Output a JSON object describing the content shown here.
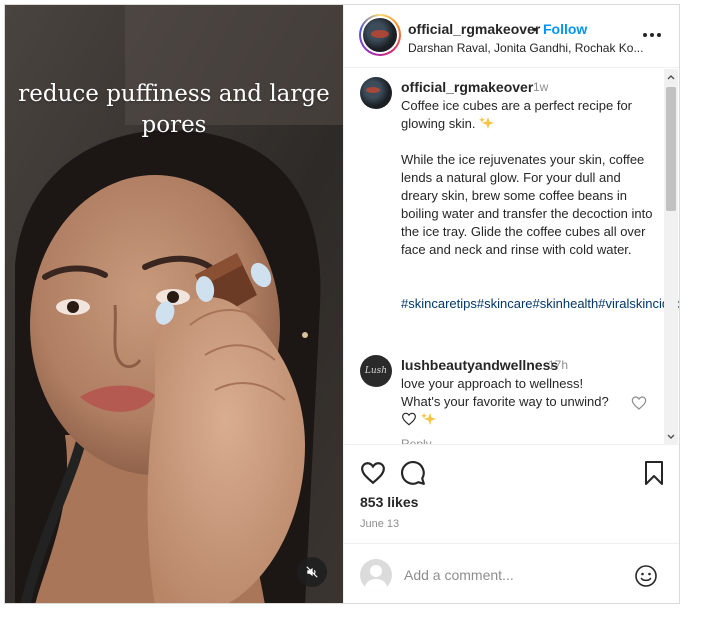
{
  "post": {
    "overlay_text": "reduce puffiness and large pores",
    "account": "official_rgmakeover",
    "follow_dot": "•",
    "follow_label": "Follow",
    "header_subtitle": "Darshan Raval, Jonita Gandhi, Rochak Ko..."
  },
  "caption": {
    "user": "official_rgmakeover",
    "time": "1w",
    "line1": "Coffee ice cubes are a perfect recipe for glowing skin.",
    "body": "While the ice rejuvenates your skin, coffee lends a natural glow. For your dull and dreary skin, brew some coffee beans in boiling water and transfer the decoction into the ice tray. Glide the coffee cubes all over face and neck and rinse with cold water.",
    "hashtags": "#skincaretips#skincare#skinhealth#viralskincideo"
  },
  "comment": {
    "user": "lushbeautyandwellness",
    "time": "17h",
    "text": "love your approach to wellness! What's your favorite way to unwind?",
    "avatar_text": "Lush",
    "reply_label": "Reply"
  },
  "stats": {
    "likes": "853 likes",
    "date": "June 13"
  },
  "composer": {
    "placeholder": "Add a comment..."
  },
  "icons": {
    "heart": "heart-icon",
    "comment": "comment-icon",
    "save": "bookmark-icon",
    "more": "more-options-icon",
    "mute": "muted-speaker-icon",
    "emoji": "emoji-icon",
    "sparkle": "sparkles-emoji"
  },
  "colors": {
    "accent": "#0095f6",
    "hashtag": "#00376b",
    "muted": "#8e8e8e"
  }
}
